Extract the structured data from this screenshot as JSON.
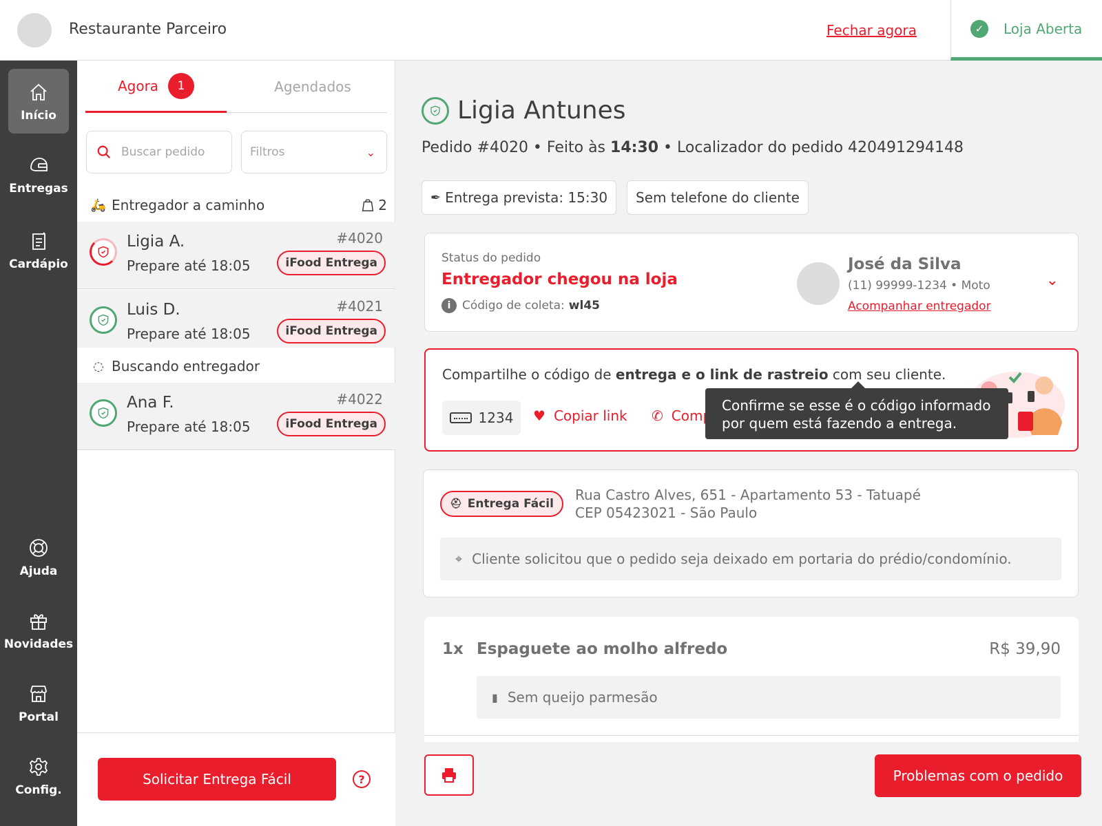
{
  "header": {
    "store_name": "Restaurante Parceiro",
    "close_link": "Fechar agora",
    "store_status": "Loja Aberta"
  },
  "sidebar": {
    "items": [
      {
        "label": "Início",
        "icon": "home-icon"
      },
      {
        "label": "Entregas",
        "icon": "helmet-icon"
      },
      {
        "label": "Cardápio",
        "icon": "menu-book-icon"
      },
      {
        "label": "Ajuda",
        "icon": "lifebuoy-icon"
      },
      {
        "label": "Novidades",
        "icon": "gift-icon"
      },
      {
        "label": "Portal",
        "icon": "store-icon"
      },
      {
        "label": "Config.",
        "icon": "gear-icon"
      }
    ]
  },
  "orders": {
    "tabs": {
      "now_label": "Agora",
      "now_count": "1",
      "scheduled_label": "Agendados"
    },
    "search": {
      "placeholder": "Buscar pedido"
    },
    "filter": {
      "label": "Filtros"
    },
    "section_on_way": {
      "title": "Entregador a caminho",
      "count": "2"
    },
    "section_searching": {
      "title": "Buscando entregador"
    },
    "list": [
      {
        "name": "Ligia A.",
        "prep": "Prepare até 18:05",
        "number": "#4020",
        "tag": "iFood Entrega"
      },
      {
        "name": "Luis D.",
        "prep": "Prepare até 18:05",
        "number": "#4021",
        "tag": "iFood Entrega"
      },
      {
        "name": "Ana F.",
        "prep": "Prepare até 18:05",
        "number": "#4022",
        "tag": "iFood Entrega"
      }
    ],
    "request_button": "Solicitar Entrega Fácil",
    "help_glyph": "?"
  },
  "detail": {
    "customer": "Ligia Antunes",
    "order_prefix": "Pedido #4020 • Feito às ",
    "order_time": "14:30",
    "locator": " • Localizador do pedido 420491294148",
    "chip_eta": "Entrega prevista: 15:30",
    "chip_phone": "Sem telefone do cliente",
    "status": {
      "label": "Status do pedido",
      "value": "Entregador chegou na loja",
      "code_label": "Código de coleta:",
      "code_value": "wl45",
      "driver_name": "José da Silva",
      "driver_info": "(11) 99999-1234 • Moto",
      "track_link": "Acompanhar entregador"
    },
    "tooltip": "Confirme se esse é o código informado por quem está fazendo a entrega.",
    "share": {
      "text_pre": "Compartilhe o código de ",
      "text_bold": "entrega e o link de rastreio",
      "text_post": " com seu cliente.",
      "code": "1234",
      "copy_label": "Copiar link",
      "share_label": "Compartilhar"
    },
    "address": {
      "tag": "Entrega Fácil",
      "line1": "Rua Castro Alves, 651 - Apartamento 53 - Tatuapé",
      "line2": "CEP 05423021 - São Paulo",
      "note": "Cliente solicitou que o pedido seja deixado em portaria do prédio/condomínio."
    },
    "items": [
      {
        "qty": "1x",
        "name": "Espaguete ao molho alfredo",
        "price": "R$ 39,90",
        "note": "Sem queijo parmesão"
      }
    ],
    "problems_button": "Problemas com o pedido"
  },
  "colors": {
    "brand_red": "#ea1d2c",
    "success_green": "#50a773",
    "sidebar_dark": "#3f3e3e"
  }
}
